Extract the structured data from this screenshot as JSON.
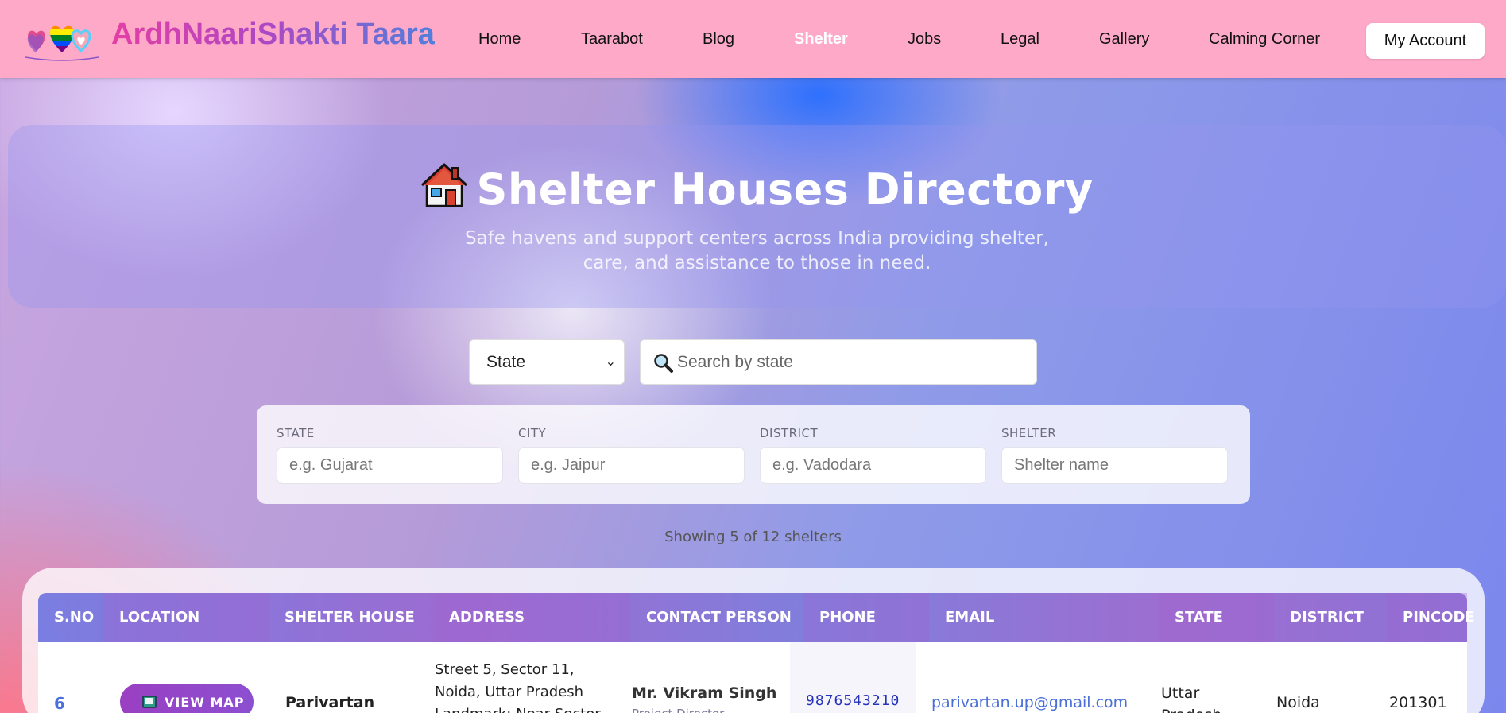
{
  "brand": {
    "name": "ArdhNaariShakti Taara"
  },
  "nav": {
    "items": [
      {
        "label": "Home"
      },
      {
        "label": "Taarabot"
      },
      {
        "label": "Blog"
      },
      {
        "label": "Shelter",
        "active": true
      },
      {
        "label": "Jobs"
      },
      {
        "label": "Legal"
      },
      {
        "label": "Gallery"
      },
      {
        "label": "Calming Corner"
      }
    ],
    "account_label": "My Account"
  },
  "hero": {
    "title": "Shelter Houses Directory",
    "subtitle": "Safe havens and support centers across India providing shelter, care, and assistance to those in need."
  },
  "search": {
    "select_value": "State",
    "placeholder": "Search by state"
  },
  "filters": [
    {
      "label": "STATE",
      "placeholder": "e.g. Gujarat"
    },
    {
      "label": "CITY",
      "placeholder": "e.g. Jaipur"
    },
    {
      "label": "DISTRICT",
      "placeholder": "e.g. Vadodara"
    },
    {
      "label": "SHELTER",
      "placeholder": "Shelter name"
    }
  ],
  "showing_text": "Showing 5 of 12 shelters",
  "table": {
    "columns": [
      "S.NO",
      "LOCATION",
      "SHELTER HOUSE",
      "ADDRESS",
      "CONTACT PERSON",
      "PHONE",
      "EMAIL",
      "STATE",
      "DISTRICT",
      "PINCODE"
    ],
    "rows": [
      {
        "sno": "6",
        "map_label": "VIEW MAP",
        "shelter": "Parivartan",
        "address_lines": [
          "Street 5, Sector 11,",
          "Noida, Uttar Pradesh",
          "Landmark: Near Sector"
        ],
        "contact_name": "Mr. Vikram Singh",
        "contact_role": "Project Director",
        "phone": "9876543210",
        "email": "parivartan.up@gmail.com",
        "state_lines": [
          "Uttar",
          "Pradesh"
        ],
        "district": "Noida",
        "pincode": "201301"
      }
    ]
  },
  "colors": {
    "navbar": "#ffa9c9",
    "nav_active": "#ffffff",
    "link": "#4a6fd8",
    "map_button": "#9a3fc2"
  }
}
